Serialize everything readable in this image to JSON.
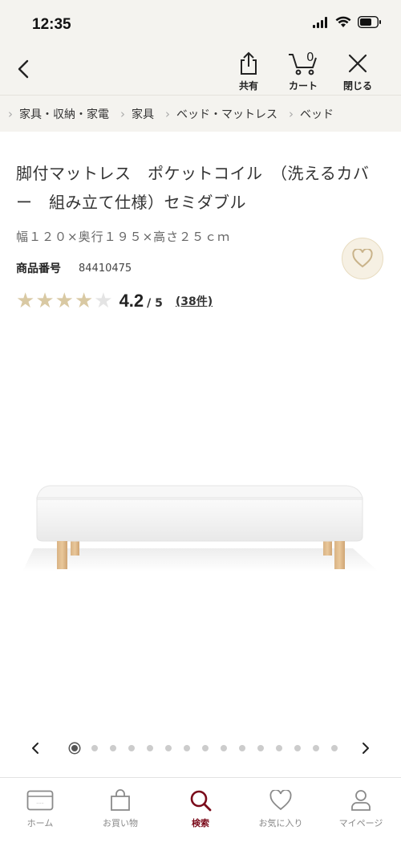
{
  "status_bar": {
    "time": "12:35"
  },
  "header": {
    "share_label": "共有",
    "cart_label": "カート",
    "cart_count": "0",
    "close_label": "閉じる"
  },
  "breadcrumb": [
    {
      "label": "家具・収納・家電"
    },
    {
      "label": "家具"
    },
    {
      "label": "ベッド・マットレス"
    },
    {
      "label": "ベッド"
    }
  ],
  "product": {
    "title": "脚付マットレス　ポケットコイル　（洗えるカバー　組み立て仕様）セミダブル",
    "size": "幅１２０×奥行１９５×高さ２５ｃｍ",
    "code_label": "商品番号",
    "code_value": "84410475",
    "rating_value": "4.2",
    "rating_max": "/ 5",
    "rating_score": 4.2,
    "review_count": "(38件)"
  },
  "carousel": {
    "total": 15,
    "active_index": 0
  },
  "bottom_nav": [
    {
      "label": "ホーム",
      "icon": "store-card-icon",
      "active": false
    },
    {
      "label": "お買い物",
      "icon": "shopping-bag-icon",
      "active": false
    },
    {
      "label": "検索",
      "icon": "search-icon",
      "active": true
    },
    {
      "label": "お気に入り",
      "icon": "heart-icon",
      "active": false
    },
    {
      "label": "マイページ",
      "icon": "person-icon",
      "active": false
    }
  ],
  "colors": {
    "header_bg": "#f4f3ef",
    "accent": "#7a0a1a",
    "star_filled": "#d9c9a3",
    "star_empty": "#e4e4e4"
  }
}
